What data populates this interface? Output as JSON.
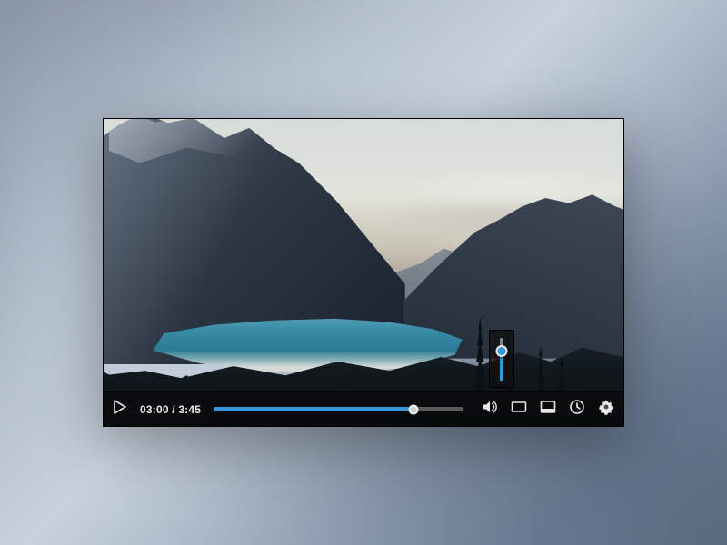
{
  "player": {
    "current_time": "03:00",
    "duration": "3:45",
    "time_separator": " / ",
    "progress_percent": 80,
    "volume_percent": 82
  },
  "icons": {
    "play": "play-icon",
    "volume": "volume-icon",
    "theater": "theater-mode-icon",
    "fullscreen": "fullscreen-icon",
    "clock": "watch-later-icon",
    "settings": "settings-gear-icon"
  },
  "colors": {
    "accent": "#3498db",
    "bar_bg": "rgba(10,10,10,0.72)",
    "text": "#eaeaea"
  }
}
